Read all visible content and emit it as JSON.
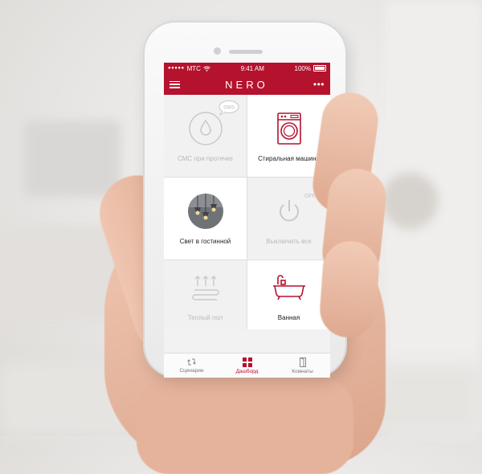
{
  "status_bar": {
    "carrier": "МТС",
    "time": "9:41 AM",
    "battery": "100%"
  },
  "nav": {
    "brand": "NERO",
    "more": "•••"
  },
  "tiles": [
    {
      "label": "СМС при протечке",
      "active": false,
      "badge": "SMS"
    },
    {
      "label": "Стиральная машина",
      "active": true
    },
    {
      "label": "Свет в гостинной",
      "active": true
    },
    {
      "label": "Выключить все",
      "active": false,
      "badge": "OFF"
    },
    {
      "label": "Теплый пол",
      "active": false
    },
    {
      "label": "Ванная",
      "active": true
    }
  ],
  "tabs": [
    {
      "label": "Сценарии",
      "active": false
    },
    {
      "label": "Дашборд",
      "active": true
    },
    {
      "label": "Комнаты",
      "active": false
    }
  ],
  "colors": {
    "accent": "#b5122e",
    "inactive": "#c2c2c2"
  }
}
